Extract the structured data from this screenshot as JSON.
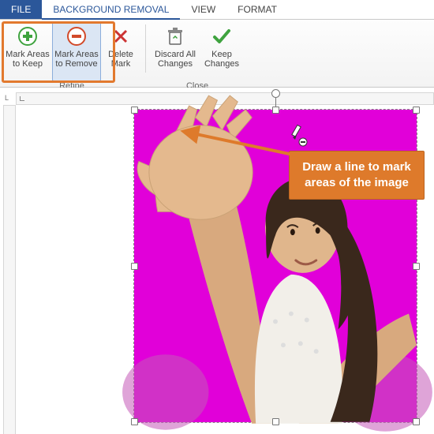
{
  "tabs": {
    "file": "FILE",
    "bg": "BACKGROUND REMOVAL",
    "view": "VIEW",
    "format": "FORMAT"
  },
  "ribbon": {
    "refine": {
      "keep": {
        "l1": "Mark Areas",
        "l2": "to Keep"
      },
      "remove": {
        "l1": "Mark Areas",
        "l2": "to Remove"
      },
      "delete": {
        "l1": "Delete",
        "l2": "Mark"
      },
      "label": "Refine"
    },
    "close": {
      "discard": {
        "l1": "Discard All",
        "l2": "Changes"
      },
      "keep": {
        "l1": "Keep",
        "l2": "Changes"
      },
      "label": "Close"
    }
  },
  "callout": "Draw a line to mark areas of the image",
  "colors": {
    "accent": "#2b579a",
    "highlight": "#e2792e",
    "mask": "#e100d9",
    "callout": "#de7a2b"
  },
  "ruler_mark": "L"
}
